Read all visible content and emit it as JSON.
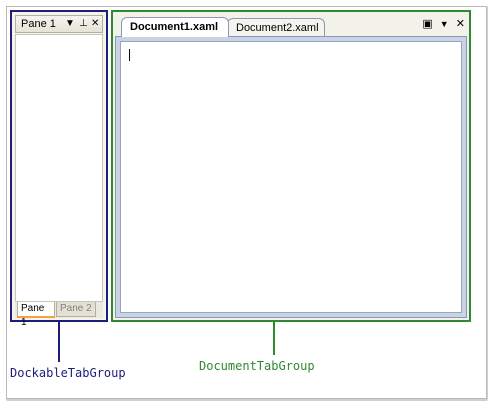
{
  "dockable_group": {
    "pane_title": "Pane 1",
    "tabs": [
      {
        "label": "Pane 1",
        "active": true
      },
      {
        "label": "Pane 2",
        "active": false
      }
    ],
    "buttons": {
      "dropdown": "▼",
      "pin": "⊥",
      "close": "✕"
    }
  },
  "document_group": {
    "tabs": [
      {
        "label": "Document1.xaml",
        "active": true
      },
      {
        "label": "Document2.xaml",
        "active": false
      }
    ],
    "controls": {
      "window_list": "▣",
      "dropdown": "▼",
      "close": "✕"
    }
  },
  "labels": {
    "dockable": "DockableTabGroup",
    "document": "DocumentTabGroup"
  },
  "colors": {
    "dockable_border": "#1d1d7a",
    "document_border": "#2f8a2f",
    "active_tab_accent": "#f4a23b"
  }
}
